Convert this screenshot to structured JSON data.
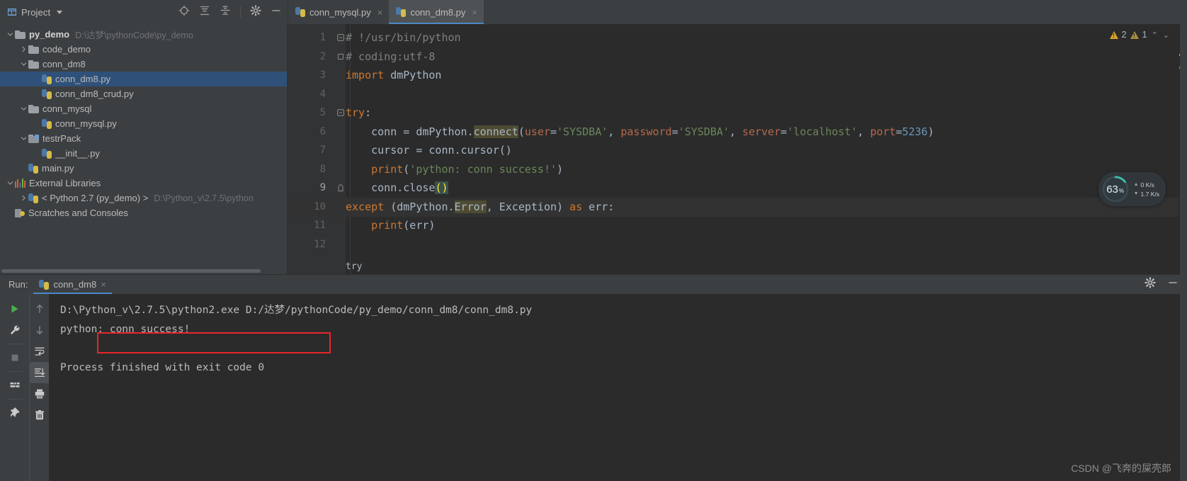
{
  "project_panel": {
    "title": "Project",
    "icons": [
      "locate-icon",
      "collapse-all-icon",
      "sort-icon",
      "settings-gear-icon",
      "minimize-icon"
    ],
    "tree": [
      {
        "label": "py_demo",
        "path": "D:\\达梦\\pythonCode\\py_demo",
        "icon": "folder-icon",
        "indent": 0,
        "expanded": true,
        "bold": true,
        "selected": false
      },
      {
        "label": "code_demo",
        "path": "",
        "icon": "folder-icon",
        "indent": 1,
        "expanded": false,
        "bold": false,
        "selected": false
      },
      {
        "label": "conn_dm8",
        "path": "",
        "icon": "folder-icon",
        "indent": 1,
        "expanded": true,
        "bold": false,
        "selected": false
      },
      {
        "label": "conn_dm8.py",
        "path": "",
        "icon": "python-file-icon",
        "indent": 2,
        "expanded": null,
        "bold": false,
        "selected": true
      },
      {
        "label": "conn_dm8_crud.py",
        "path": "",
        "icon": "python-file-icon",
        "indent": 2,
        "expanded": null,
        "bold": false,
        "selected": false
      },
      {
        "label": "conn_mysql",
        "path": "",
        "icon": "folder-icon",
        "indent": 1,
        "expanded": true,
        "bold": false,
        "selected": false
      },
      {
        "label": "conn_mysql.py",
        "path": "",
        "icon": "python-file-icon",
        "indent": 2,
        "expanded": null,
        "bold": false,
        "selected": false
      },
      {
        "label": "testrPack",
        "path": "",
        "icon": "source-folder-icon",
        "indent": 1,
        "expanded": true,
        "bold": false,
        "selected": false
      },
      {
        "label": "__init__.py",
        "path": "",
        "icon": "python-file-icon",
        "indent": 2,
        "expanded": null,
        "bold": false,
        "selected": false
      },
      {
        "label": "main.py",
        "path": "",
        "icon": "python-file-icon",
        "indent": 1,
        "expanded": null,
        "bold": false,
        "selected": false
      },
      {
        "label": "External Libraries",
        "path": "",
        "icon": "libraries-icon",
        "indent": 0,
        "expanded": true,
        "bold": false,
        "selected": false
      },
      {
        "label": "< Python 2.7 (py_demo) >",
        "path": "D:\\Python_v\\2.7.5\\python",
        "icon": "python-interpreter-icon",
        "indent": 1,
        "expanded": false,
        "bold": false,
        "selected": false
      },
      {
        "label": "Scratches and Consoles",
        "path": "",
        "icon": "scratches-icon",
        "indent": 0,
        "expanded": null,
        "bold": false,
        "selected": false
      }
    ]
  },
  "tabs": [
    {
      "label": "conn_mysql.py",
      "icon": "python-file-icon",
      "active": false,
      "close": "×"
    },
    {
      "label": "conn_dm8.py",
      "icon": "python-file-icon",
      "active": true,
      "close": "×"
    }
  ],
  "editor": {
    "line_numbers": [
      "1",
      "2",
      "3",
      "4",
      "5",
      "6",
      "7",
      "8",
      "9",
      "10",
      "11",
      "12"
    ],
    "current_line": 9,
    "breadcrumb": "try",
    "lines": [
      {
        "n": 1,
        "tokens": [
          {
            "t": "# !/usr/bin/python",
            "c": "cmt"
          }
        ]
      },
      {
        "n": 2,
        "tokens": [
          {
            "t": "# coding:utf-8",
            "c": "cmt"
          }
        ]
      },
      {
        "n": 3,
        "tokens": [
          {
            "t": "import",
            "c": "kw"
          },
          {
            "t": " dmPython",
            "c": "plain"
          }
        ]
      },
      {
        "n": 4,
        "tokens": []
      },
      {
        "n": 5,
        "tokens": [
          {
            "t": "try",
            "c": "kw"
          },
          {
            "t": ":",
            "c": "plain"
          }
        ]
      },
      {
        "n": 6,
        "tokens": [
          {
            "t": "    conn = dmPython.",
            "c": "plain"
          },
          {
            "t": "connect",
            "c": "hlid"
          },
          {
            "t": "(",
            "c": "plain"
          },
          {
            "t": "user",
            "c": "param"
          },
          {
            "t": "=",
            "c": "plain"
          },
          {
            "t": "'SYSDBA'",
            "c": "str"
          },
          {
            "t": ", ",
            "c": "plain"
          },
          {
            "t": "password",
            "c": "param"
          },
          {
            "t": "=",
            "c": "plain"
          },
          {
            "t": "'SYSDBA'",
            "c": "str"
          },
          {
            "t": ", ",
            "c": "plain"
          },
          {
            "t": "server",
            "c": "param"
          },
          {
            "t": "=",
            "c": "plain"
          },
          {
            "t": "'localhost'",
            "c": "str"
          },
          {
            "t": ", ",
            "c": "plain"
          },
          {
            "t": "port",
            "c": "param"
          },
          {
            "t": "=",
            "c": "plain"
          },
          {
            "t": "5236",
            "c": "num"
          },
          {
            "t": ")",
            "c": "plain"
          }
        ]
      },
      {
        "n": 7,
        "tokens": [
          {
            "t": "    cursor = conn.cursor()",
            "c": "plain"
          }
        ]
      },
      {
        "n": 8,
        "tokens": [
          {
            "t": "    ",
            "c": "plain"
          },
          {
            "t": "print",
            "c": "kw"
          },
          {
            "t": "(",
            "c": "plain"
          },
          {
            "t": "'python: conn success!'",
            "c": "str"
          },
          {
            "t": ")",
            "c": "plain"
          }
        ]
      },
      {
        "n": 9,
        "tokens": [
          {
            "t": "    conn.close",
            "c": "plain"
          },
          {
            "t": "()",
            "c": "brmatch"
          }
        ]
      },
      {
        "n": 10,
        "tokens": [
          {
            "t": "except",
            "c": "kw"
          },
          {
            "t": " (dmPython.",
            "c": "plain"
          },
          {
            "t": "Error",
            "c": "hlid"
          },
          {
            "t": ", ",
            "c": "plain"
          },
          {
            "t": "Exception",
            "c": "cls"
          },
          {
            "t": ") ",
            "c": "plain"
          },
          {
            "t": "as",
            "c": "kw"
          },
          {
            "t": " err:",
            "c": "plain"
          }
        ]
      },
      {
        "n": 11,
        "tokens": [
          {
            "t": "    ",
            "c": "plain"
          },
          {
            "t": "print",
            "c": "kw"
          },
          {
            "t": "(err)",
            "c": "plain"
          }
        ]
      },
      {
        "n": 12,
        "tokens": []
      }
    ],
    "inspection": {
      "warning_count": "2",
      "weak_warning_count": "1",
      "up_chevron": "⌃",
      "down_chevron": "⌄"
    }
  },
  "cpu_widget": {
    "percent": "63",
    "percent_suffix": "%",
    "upload_speed": "0 K/s",
    "download_speed": "1.7 K/s",
    "ring_color": "#3fbfad"
  },
  "run_panel": {
    "label": "Run:",
    "tab_label": "conn_dm8",
    "tab_close": "×",
    "header_icons": [
      "settings-gear-icon",
      "minimize-icon"
    ],
    "tools": [
      "rerun-icon",
      "wrench-icon",
      "stop-icon",
      "layout-icon",
      "pin-icon"
    ],
    "tools2": [
      "up-arrow-icon",
      "down-arrow-icon",
      "soft-wrap-icon",
      "scroll-to-end-icon",
      "print-icon",
      "trash-icon"
    ],
    "console_lines": [
      "D:\\Python_v\\2.7.5\\python2.exe D:/达梦/pythonCode/py_demo/conn_dm8/conn_dm8.py",
      "python: conn success!",
      "",
      "Process finished with exit code 0"
    ],
    "highlight_box_color": "#e8262a"
  },
  "watermark": "CSDN @飞奔的屎壳郎"
}
